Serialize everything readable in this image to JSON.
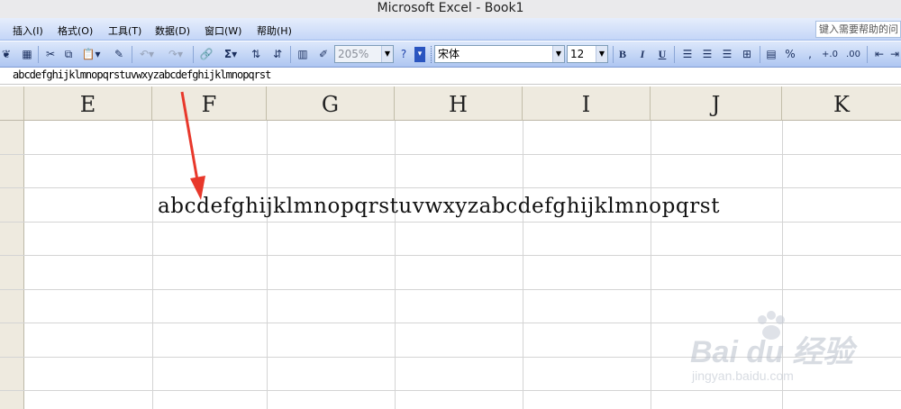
{
  "window": {
    "title": "Microsoft Excel - Book1"
  },
  "menu": {
    "items": [
      "插入(I)",
      "格式(O)",
      "工具(T)",
      "数据(D)",
      "窗口(W)",
      "帮助(H)"
    ],
    "help_placeholder": "键入需要帮助的问"
  },
  "toolbar": {
    "zoom": "205%",
    "font": "宋体",
    "font_size": "12",
    "bold": "B",
    "italic": "I",
    "underline": "U",
    "autosum": "Σ",
    "percent": "%",
    "comma": ","
  },
  "formula_bar": {
    "value": "abcdefghijklmnopqrstuvwxyzabcdefghijklmnopqrst"
  },
  "columns": [
    "E",
    "F",
    "G",
    "H",
    "I",
    "J",
    "K"
  ],
  "cell": {
    "text": "abcdefghijklmnopqrstuvwxyzabcdefghijklmnopqrst"
  },
  "annotation": {
    "arrow_color": "#e8382b"
  },
  "watermark": {
    "brand": "Bai du 经验",
    "url": "jingyan.baidu.com"
  }
}
